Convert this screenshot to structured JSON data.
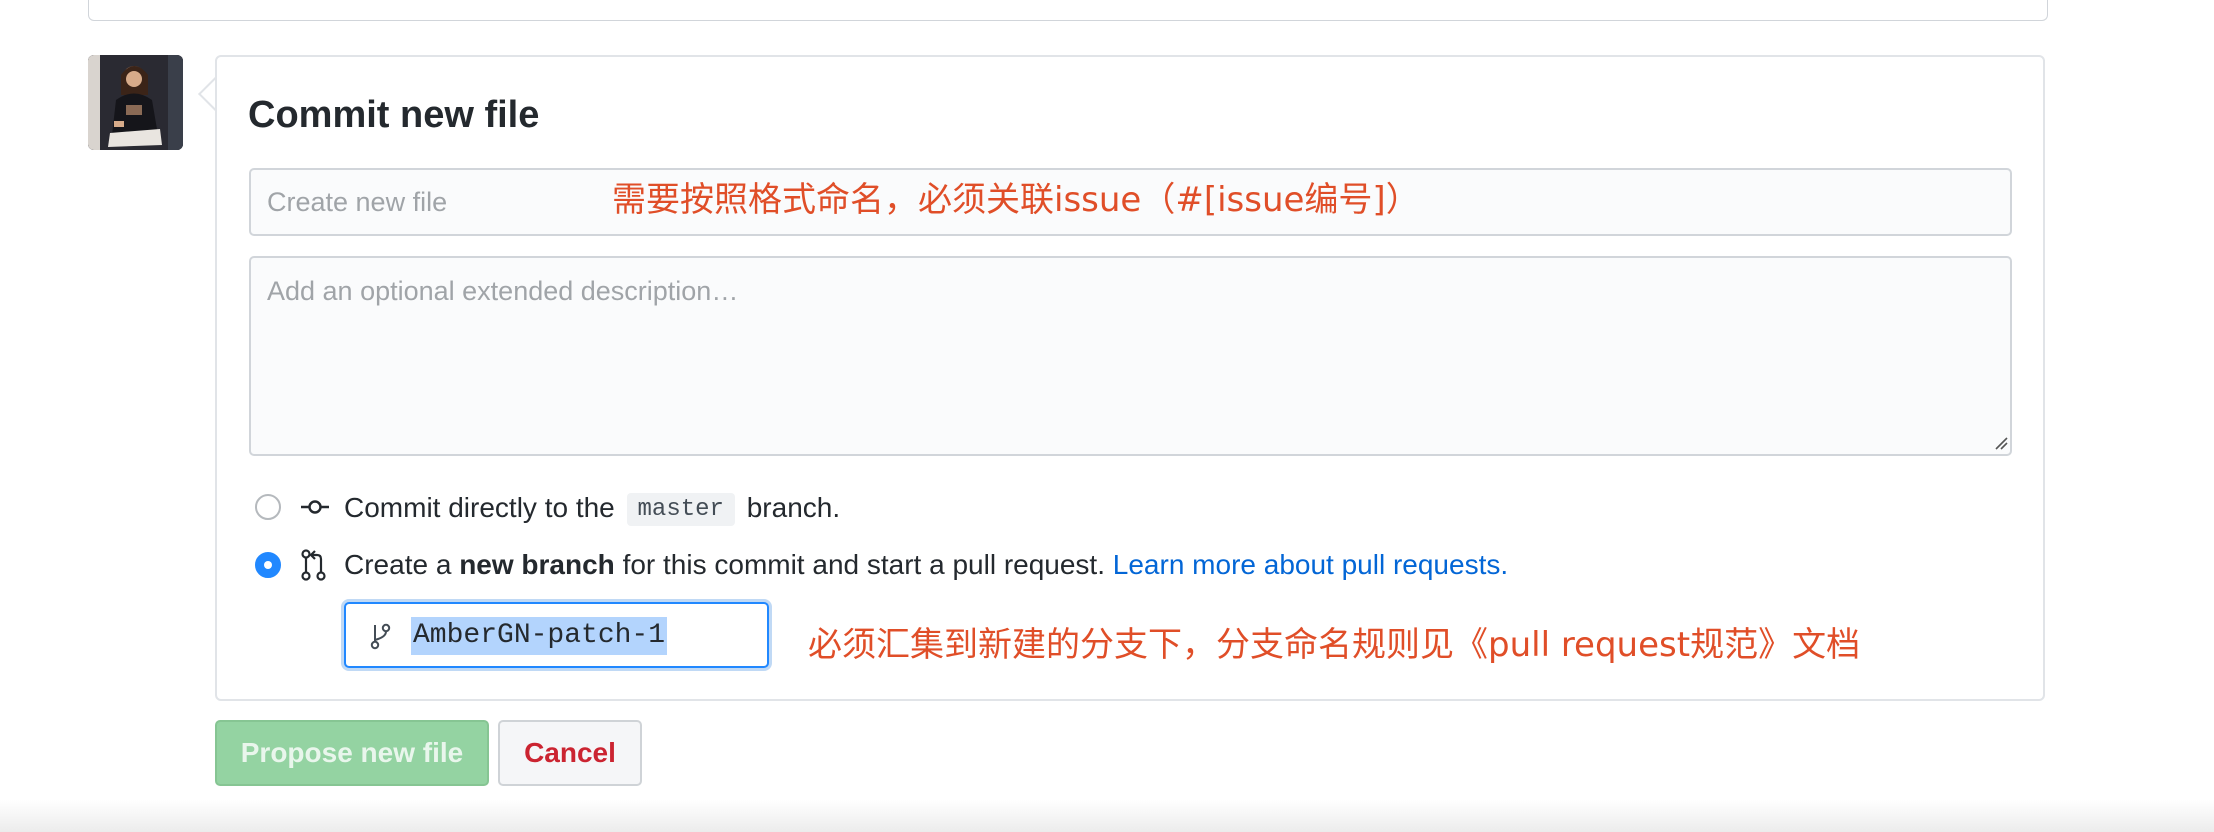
{
  "commit": {
    "title": "Commit new file",
    "summary_placeholder": "Create new file",
    "summary_value": "",
    "description_placeholder": "Add an optional extended description…",
    "description_value": ""
  },
  "annotations": {
    "summary_note": "需要按照格式命名，必须关联issue（#[issue编号]）",
    "branch_note": "必须汇集到新建的分支下，分支命名规则见《pull request规范》文档"
  },
  "options": {
    "direct": {
      "prefix": "Commit directly to the",
      "branch_code": "master",
      "suffix": "branch.",
      "selected": false
    },
    "new_branch": {
      "prefix": "Create a",
      "bold": "new branch",
      "middle": "for this commit and start a pull request.",
      "link": "Learn more about pull requests.",
      "selected": true
    }
  },
  "branch_name": {
    "value": "AmberGN-patch-1"
  },
  "buttons": {
    "propose": "Propose new file",
    "cancel": "Cancel"
  },
  "colors": {
    "annotation": "#e04e28",
    "link": "#0366d6",
    "propose_button": "#94d3a2",
    "cancel_text": "#cb2431",
    "radio_selected": "#2188ff"
  },
  "icons": {
    "direct_commit": "git-commit-icon",
    "pull_request": "git-pull-request-icon",
    "branch": "git-branch-icon"
  }
}
